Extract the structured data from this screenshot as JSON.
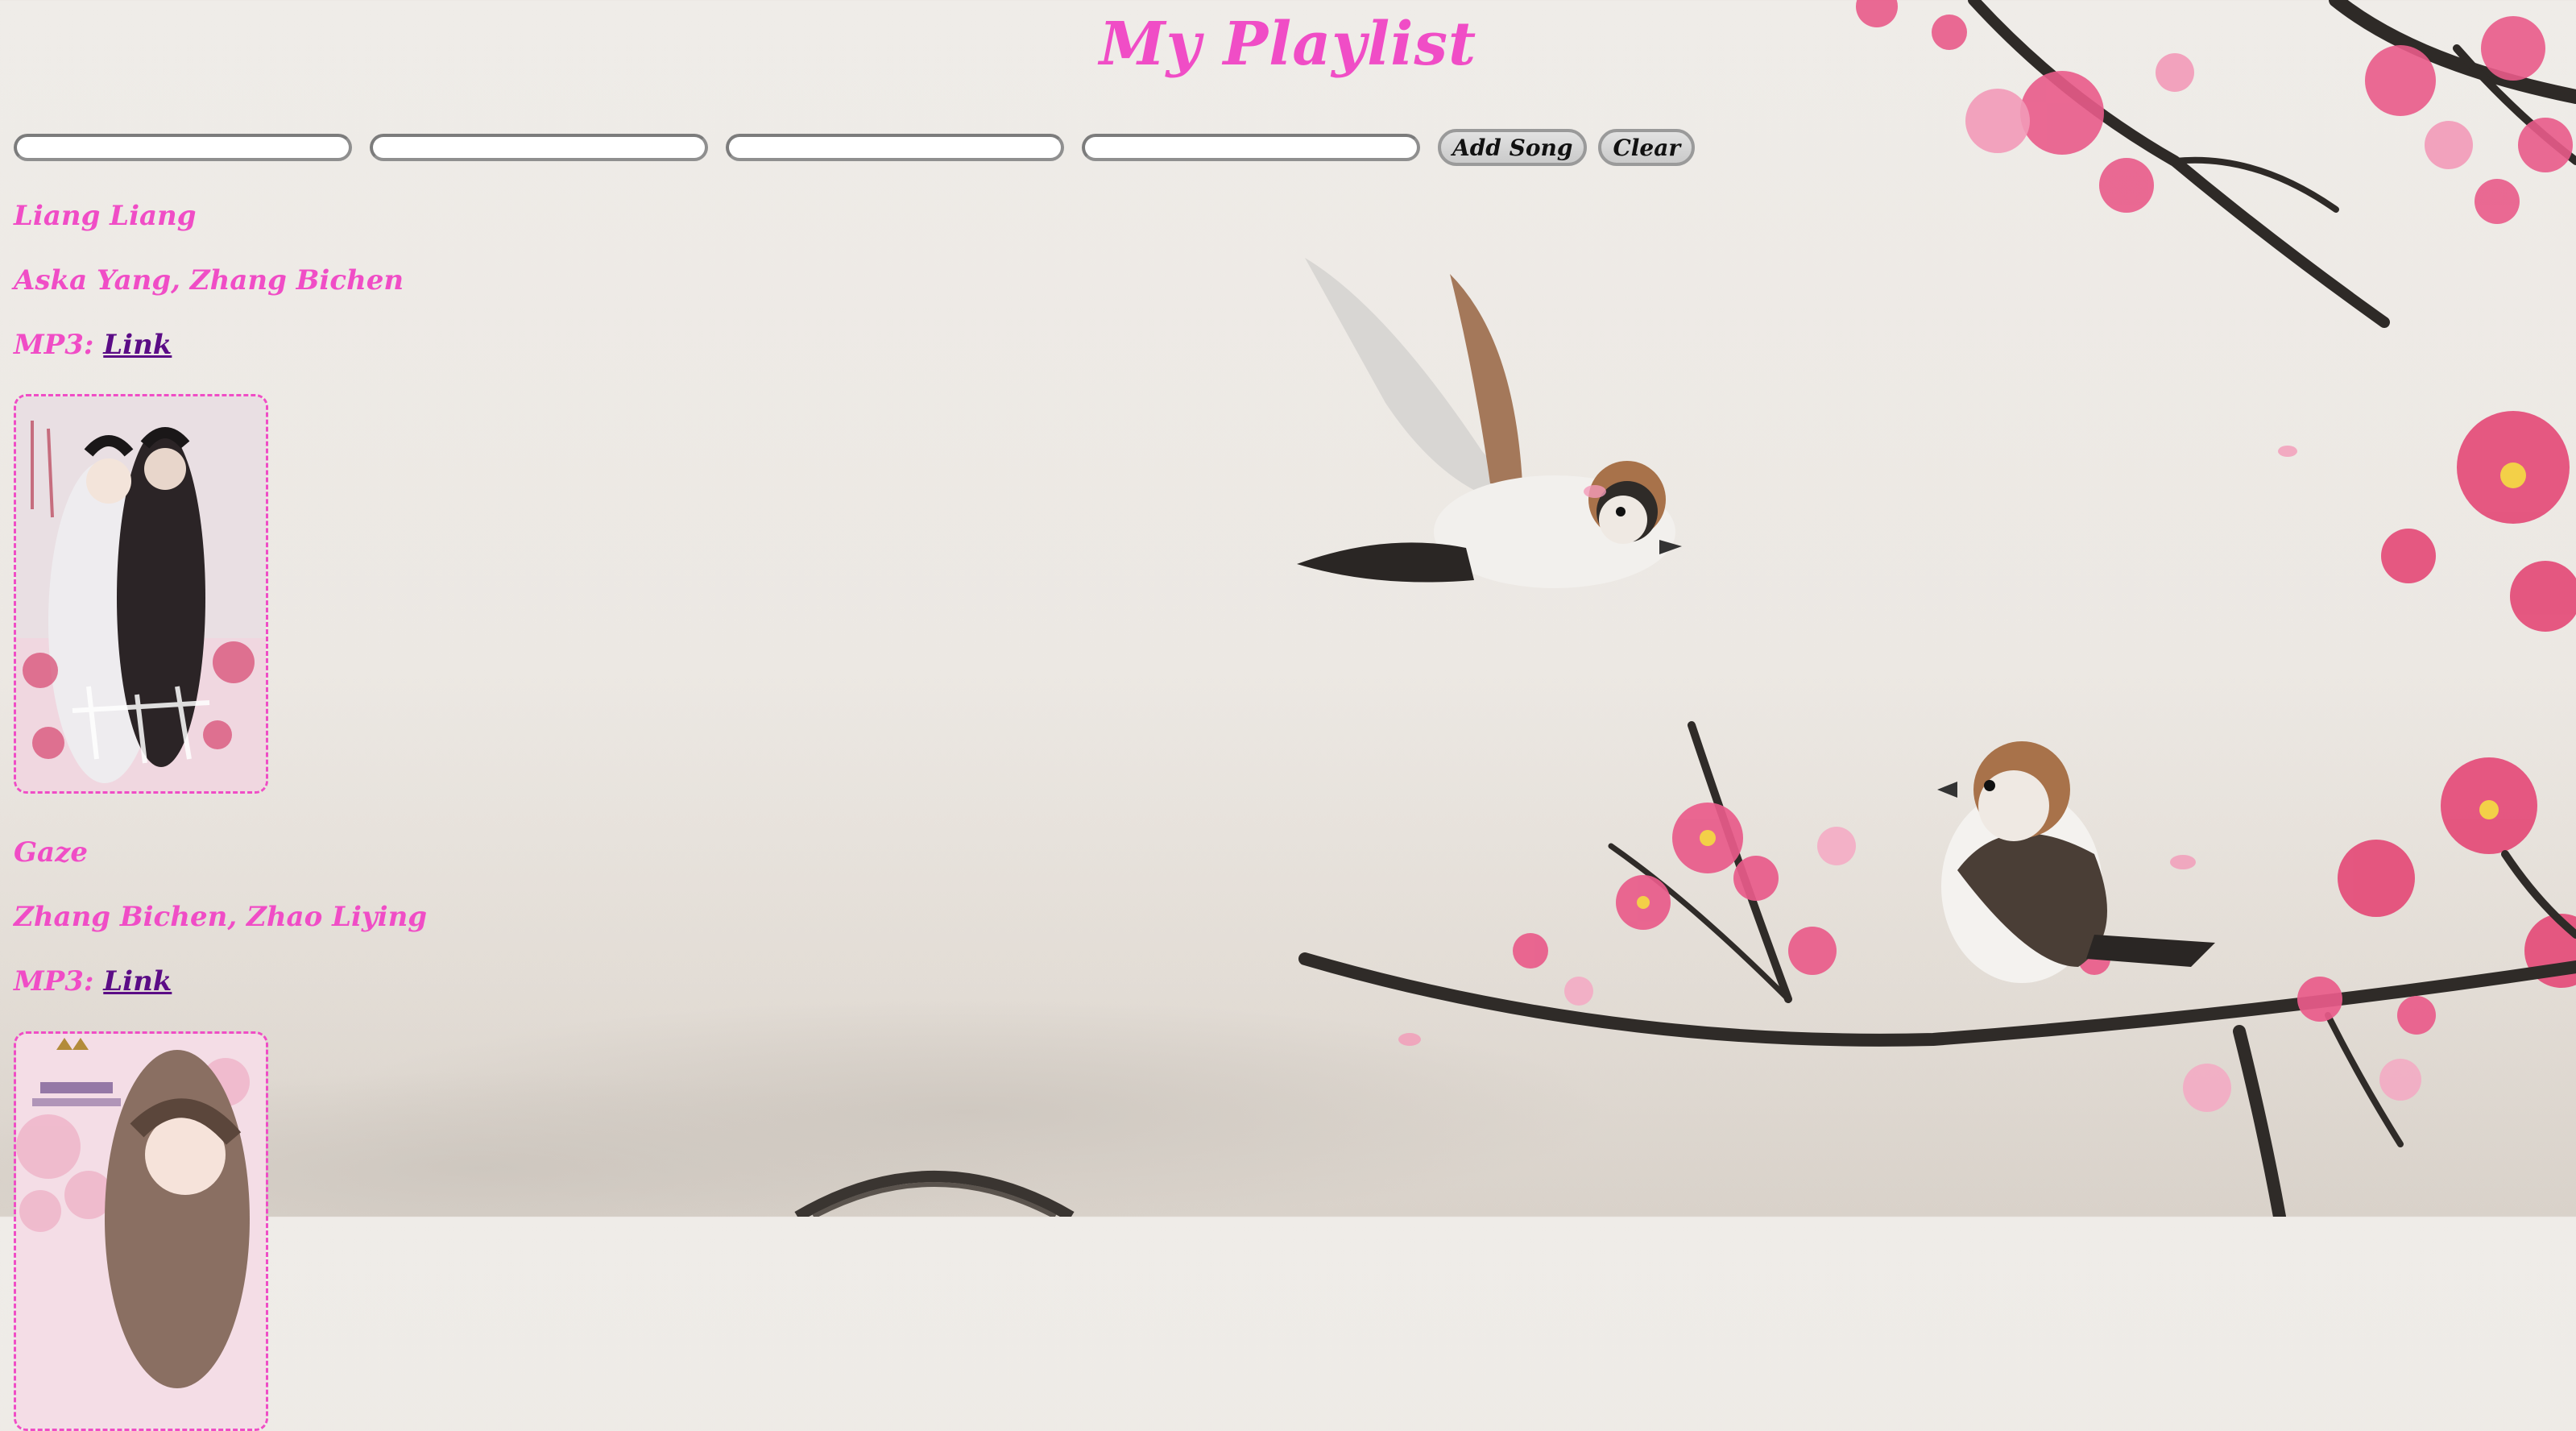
{
  "header": {
    "title": "My Playlist"
  },
  "form": {
    "inputs": [
      {
        "name": "title",
        "value": ""
      },
      {
        "name": "artist",
        "value": ""
      },
      {
        "name": "mp3",
        "value": ""
      },
      {
        "name": "image",
        "value": ""
      }
    ],
    "add_label": "Add Song",
    "clear_label": "Clear"
  },
  "songs": [
    {
      "title": "Liang Liang",
      "artists": "Aska Yang, Zhang Bichen",
      "mp3_prefix": "MP3: ",
      "link_label": "Link"
    },
    {
      "title": "Gaze",
      "artists": "Zhang Bichen, Zhao Liying",
      "mp3_prefix": "MP3: ",
      "link_label": "Link"
    }
  ],
  "colors": {
    "accent": "#f04dc6",
    "link": "#5b0c86"
  }
}
